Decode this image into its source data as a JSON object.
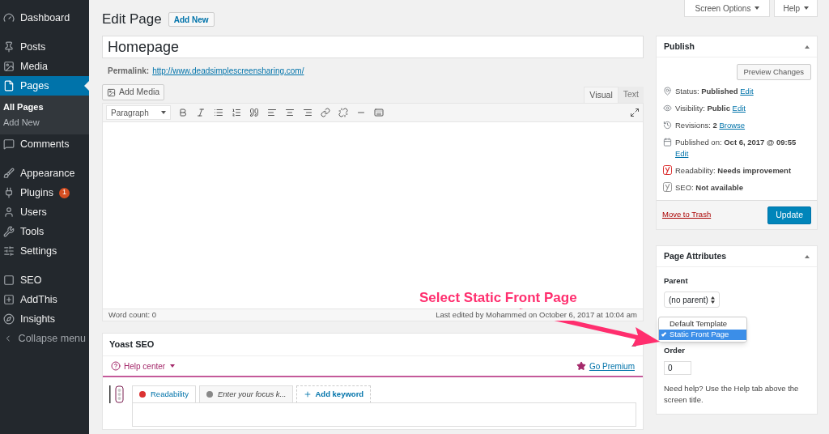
{
  "sidebar": {
    "groups": [
      [
        {
          "label": "Dashboard",
          "selected": false
        }
      ],
      [
        {
          "label": "Posts",
          "selected": false
        },
        {
          "label": "Media",
          "selected": false
        },
        {
          "label": "Pages",
          "selected": true,
          "children": [
            {
              "label": "All Pages",
              "selected": true
            },
            {
              "label": "Add New",
              "selected": false
            }
          ]
        },
        {
          "label": "Comments",
          "selected": false
        }
      ],
      [
        {
          "label": "Appearance",
          "selected": false
        },
        {
          "label": "Plugins",
          "selected": false,
          "badge": "1"
        },
        {
          "label": "Users",
          "selected": false
        },
        {
          "label": "Tools",
          "selected": false
        },
        {
          "label": "Settings",
          "selected": false
        }
      ],
      [
        {
          "label": "SEO",
          "selected": false
        },
        {
          "label": "AddThis",
          "selected": false
        },
        {
          "label": "Insights",
          "selected": false
        },
        {
          "label": "Collapse menu",
          "selected": false
        }
      ]
    ]
  },
  "header": {
    "title": "Edit Page",
    "add_new": "Add New",
    "screen_options": "Screen Options",
    "help": "Help"
  },
  "editor": {
    "title_value": "Homepage",
    "permalink_label": "Permalink:",
    "permalink": "http://www.deadsimplescreensharing.com/",
    "add_media": "Add Media",
    "tabs": [
      {
        "label": "Visual",
        "selected": true
      },
      {
        "label": "Text",
        "selected": false
      }
    ],
    "format": "Paragraph",
    "word_count": "Word count: 0",
    "last_edited": "Last edited by Mohammed on October 6, 2017 at 10:04 am"
  },
  "yoast": {
    "title": "Yoast SEO",
    "help_center": "Help center",
    "go_premium": "Go Premium",
    "tabs": [
      {
        "kind": "dot",
        "label": "Readability",
        "color": "#dc3232",
        "selected": true
      },
      {
        "kind": "dot",
        "label": "Enter your focus k...",
        "color": "#888888",
        "selected": false
      },
      {
        "kind": "add",
        "label": "Add keyword"
      }
    ]
  },
  "publish": {
    "title": "Publish",
    "preview": "Preview Changes",
    "rows": [
      {
        "label": "Status:",
        "value": "Published",
        "link": "Edit"
      },
      {
        "label": "Visibility:",
        "value": "Public",
        "link": "Edit"
      },
      {
        "label": "Revisions:",
        "value": "2",
        "link": "Browse"
      },
      {
        "label": "Published on:",
        "value": "Oct 6, 2017 @ 09:55",
        "link": "Edit"
      },
      {
        "label": "Readability:",
        "value": "Needs improvement"
      },
      {
        "label": "SEO:",
        "value": "Not available"
      }
    ],
    "trash": "Move to Trash",
    "update": "Update"
  },
  "page_attributes": {
    "title": "Page Attributes",
    "parent_label": "Parent",
    "parent_value": "(no parent)",
    "template_options": [
      {
        "label": "Default Template",
        "selected": false
      },
      {
        "label": "Static Front Page",
        "selected": true
      }
    ],
    "order_label": "Order",
    "order_value": "0",
    "help": "Need help? Use the Help tab above the screen title."
  },
  "annotation": {
    "text": "Select Static Front Page"
  }
}
